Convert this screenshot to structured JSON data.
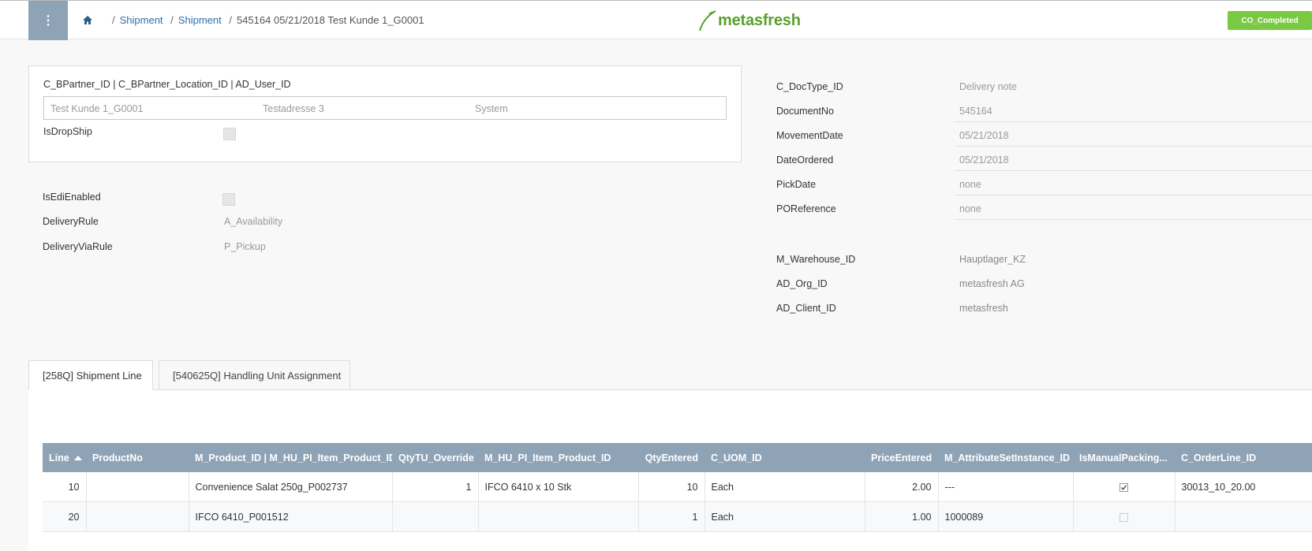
{
  "breadcrumb": {
    "items": [
      "Shipment",
      "Shipment"
    ],
    "current": "545164 05/21/2018 Test Kunde 1_G0001"
  },
  "logo": {
    "text": "metasfresh"
  },
  "status": {
    "label": "CO_Completed",
    "color": "#7ac943"
  },
  "partner_panel": {
    "label": "C_BPartner_ID | C_BPartner_Location_ID | AD_User_ID",
    "partner": "Test Kunde 1_G0001",
    "location": "Testadresse 3",
    "user": "System",
    "dropship_label": "IsDropShip"
  },
  "left_fields": {
    "edi_label": "IsEdiEnabled",
    "delivery_rule_label": "DeliveryRule",
    "delivery_rule_value": "A_Availability",
    "delivery_via_label": "DeliveryViaRule",
    "delivery_via_value": "P_Pickup"
  },
  "right_fields": [
    {
      "label": "C_DocType_ID",
      "value": "Delivery note"
    },
    {
      "label": "DocumentNo",
      "value": "545164"
    },
    {
      "label": "MovementDate",
      "value": "05/21/2018"
    },
    {
      "label": "DateOrdered",
      "value": "05/21/2018"
    },
    {
      "label": "PickDate",
      "value": "none"
    },
    {
      "label": "POReference",
      "value": "none"
    }
  ],
  "org_fields": [
    {
      "label": "M_Warehouse_ID",
      "value": "Hauptlager_KZ"
    },
    {
      "label": "AD_Org_ID",
      "value": "metasfresh AG"
    },
    {
      "label": "AD_Client_ID",
      "value": "metasfresh"
    }
  ],
  "tabs": [
    {
      "label": "[258Q] Shipment Line"
    },
    {
      "label": "[540625Q] Handling Unit Assignment"
    }
  ],
  "grid": {
    "columns": [
      "Line",
      "ProductNo",
      "M_Product_ID | M_HU_PI_Item_Product_ID",
      "QtyTU_Override",
      "M_HU_PI_Item_Product_ID",
      "QtyEntered",
      "C_UOM_ID",
      "PriceEntered",
      "M_AttributeSetInstance_ID",
      "IsManualPacking...",
      "C_OrderLine_ID"
    ],
    "rows": [
      {
        "line": "10",
        "productno": "",
        "product": "Convenience Salat 250g_P002737",
        "qtytu": "1",
        "hupi": "IFCO 6410 x 10 Stk",
        "qty": "10",
        "uom": "Each",
        "price": "2.00",
        "asi": "---",
        "manual": true,
        "orderline": "30013_10_20.00"
      },
      {
        "line": "20",
        "productno": "",
        "product": "IFCO 6410_P001512",
        "qtytu": "",
        "hupi": "",
        "qty": "1",
        "uom": "Each",
        "price": "1.00",
        "asi": "1000089",
        "manual": false,
        "orderline": ""
      }
    ]
  }
}
